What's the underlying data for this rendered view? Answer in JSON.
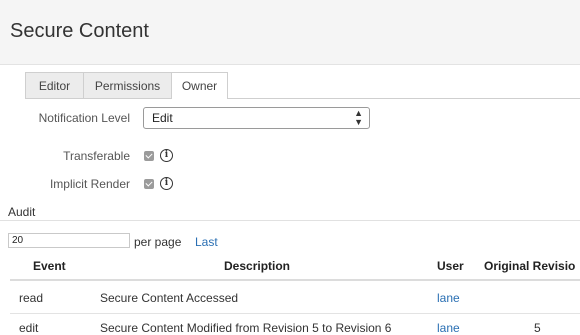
{
  "header": {
    "title": "Secure Content"
  },
  "tabs": [
    {
      "label": "Editor"
    },
    {
      "label": "Permissions"
    },
    {
      "label": "Owner"
    }
  ],
  "form": {
    "notification_level": {
      "label": "Notification Level",
      "value": "Edit"
    },
    "transferable": {
      "label": "Transferable",
      "checked": true
    },
    "implicit_render": {
      "label": "Implicit Render",
      "checked": true
    }
  },
  "audit": {
    "heading": "Audit",
    "per_page_value": "20",
    "per_page_label": "per page",
    "last_link": "Last",
    "columns": [
      "Event",
      "Description",
      "User",
      "Original Revisio"
    ],
    "rows": [
      {
        "event": "read",
        "description": "Secure Content Accessed",
        "user": "lane",
        "revision": ""
      },
      {
        "event": "edit",
        "description": "Secure Content Modified from Revision 5 to Revision 6",
        "user": "lane",
        "revision": "5"
      }
    ]
  },
  "colors": {
    "link": "#2a6fb3",
    "header_bg": "#f5f5f5",
    "tab_bg": "#ececec"
  }
}
